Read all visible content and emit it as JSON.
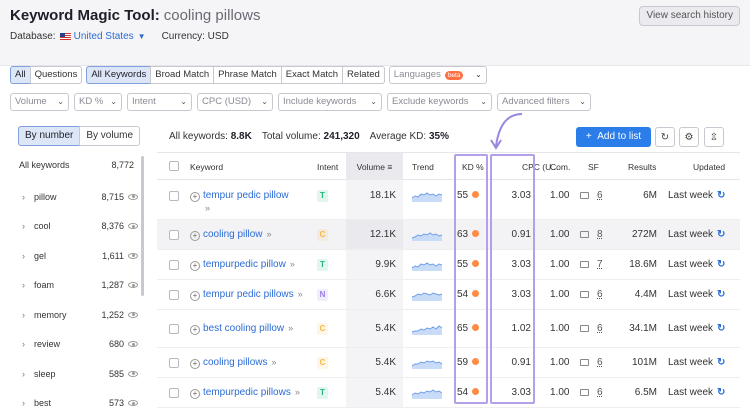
{
  "header": {
    "title": "Keyword Magic Tool:",
    "keyword": "cooling pillows",
    "history_button": "View search history",
    "database_label": "Database:",
    "database_value": "United States",
    "currency_label": "Currency: USD"
  },
  "tabs": {
    "all": "All",
    "questions": "Questions",
    "all_keywords": "All Keywords",
    "broad": "Broad Match",
    "phrase": "Phrase Match",
    "exact": "Exact Match",
    "related": "Related",
    "languages": "Languages",
    "beta": "beta"
  },
  "filters": {
    "volume": "Volume",
    "kd": "KD %",
    "intent": "Intent",
    "cpc": "CPC (USD)",
    "include": "Include keywords",
    "exclude": "Exclude keywords",
    "advanced": "Advanced filters"
  },
  "sidebar": {
    "by_number": "By number",
    "by_volume": "By volume",
    "all_label": "All keywords",
    "all_count": "8,772",
    "items": [
      {
        "label": "pillow",
        "count": "8,715"
      },
      {
        "label": "cool",
        "count": "8,376"
      },
      {
        "label": "gel",
        "count": "1,611"
      },
      {
        "label": "foam",
        "count": "1,287"
      },
      {
        "label": "memory",
        "count": "1,252"
      },
      {
        "label": "review",
        "count": "680"
      },
      {
        "label": "sleep",
        "count": "585"
      },
      {
        "label": "best",
        "count": "573"
      }
    ]
  },
  "summary": {
    "all_label": "All keywords:",
    "all_value": "8.8K",
    "volume_label": "Total volume:",
    "volume_value": "241,320",
    "kd_label": "Average KD:",
    "kd_value": "35%",
    "add_button": "Add to list"
  },
  "table": {
    "columns": {
      "keyword": "Keyword",
      "intent": "Intent",
      "volume": "Volume",
      "trend": "Trend",
      "kd": "KD %",
      "cpc": "CPC (U...",
      "com": "Com.",
      "sf": "SF",
      "results": "Results",
      "updated": "Updated"
    },
    "rows": [
      {
        "keyword": "tempur pedic pillow",
        "intent": "T",
        "volume": "18.1K",
        "kd": "55",
        "cpc": "3.03",
        "com": "1.00",
        "sf": "6",
        "results": "6M",
        "updated": "Last week"
      },
      {
        "keyword": "cooling pillow",
        "intent": "C",
        "volume": "12.1K",
        "kd": "63",
        "cpc": "0.91",
        "com": "1.00",
        "sf": "8",
        "results": "272M",
        "updated": "Last week"
      },
      {
        "keyword": "tempurpedic pillow",
        "intent": "T",
        "volume": "9.9K",
        "kd": "55",
        "cpc": "3.03",
        "com": "1.00",
        "sf": "7",
        "results": "18.6M",
        "updated": "Last week"
      },
      {
        "keyword": "tempur pedic pillows",
        "intent": "N",
        "volume": "6.6K",
        "kd": "54",
        "cpc": "3.03",
        "com": "1.00",
        "sf": "6",
        "results": "4.4M",
        "updated": "Last week"
      },
      {
        "keyword": "best cooling pillow",
        "intent": "C",
        "volume": "5.4K",
        "kd": "65",
        "cpc": "1.02",
        "com": "1.00",
        "sf": "6",
        "results": "34.1M",
        "updated": "Last week"
      },
      {
        "keyword": "cooling pillows",
        "intent": "C",
        "volume": "5.4K",
        "kd": "59",
        "cpc": "0.91",
        "com": "1.00",
        "sf": "6",
        "results": "101M",
        "updated": "Last week"
      },
      {
        "keyword": "tempurpedic pillows",
        "intent": "T",
        "volume": "5.4K",
        "kd": "54",
        "cpc": "3.03",
        "com": "1.00",
        "sf": "6",
        "results": "6.5M",
        "updated": "Last week"
      }
    ]
  },
  "colors": {
    "intent_T": "#27b881",
    "intent_C": "#f4b942",
    "intent_N": "#9b7be8",
    "kd_dot": "#ff8c42",
    "highlight": "#b3a0e8",
    "link": "#2b6cd4"
  }
}
